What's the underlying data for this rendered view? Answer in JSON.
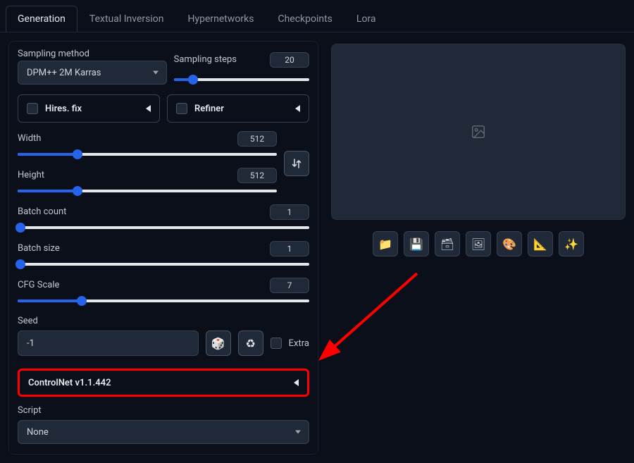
{
  "tabs": {
    "generation": "Generation",
    "textual_inversion": "Textual Inversion",
    "hypernetworks": "Hypernetworks",
    "checkpoints": "Checkpoints",
    "lora": "Lora"
  },
  "sampling": {
    "method_label": "Sampling method",
    "method_value": "DPM++ 2M Karras",
    "steps_label": "Sampling steps",
    "steps_value": "20"
  },
  "accordions": {
    "hires_fix": "Hires. fix",
    "refiner": "Refiner",
    "controlnet": "ControlNet v1.1.442"
  },
  "dims": {
    "width_label": "Width",
    "width_value": "512",
    "height_label": "Height",
    "height_value": "512"
  },
  "batch": {
    "count_label": "Batch count",
    "count_value": "1",
    "size_label": "Batch size",
    "size_value": "1"
  },
  "cfg": {
    "label": "CFG Scale",
    "value": "7"
  },
  "seed": {
    "label": "Seed",
    "value": "-1",
    "extra_label": "Extra"
  },
  "script": {
    "label": "Script",
    "value": "None"
  },
  "icons": {
    "dice": "🎲",
    "recycle": "♻",
    "folder": "📁",
    "save": "💾",
    "archive": "🗃",
    "image": "🖼",
    "palette": "🎨",
    "ruler": "📐",
    "sparkles": "✨"
  }
}
